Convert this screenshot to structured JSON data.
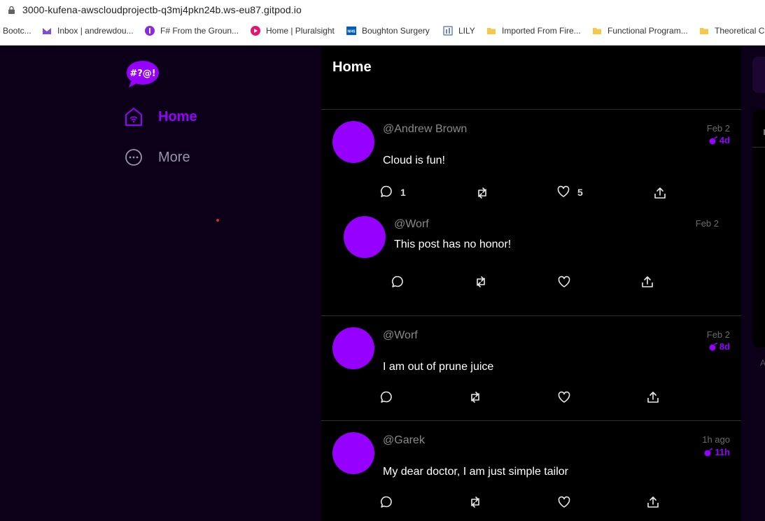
{
  "browser": {
    "url": "3000-kufena-awscloudprojectb-q3mj4pkn24b.ws-eu87.gitpod.io",
    "bookmarks": [
      {
        "label": "Bootc...",
        "color": "#ffffff"
      },
      {
        "label": "Inbox | andrewdou...",
        "color": "#7b4fd6"
      },
      {
        "label": "F# From the Groun...",
        "color": "#8a2be2"
      },
      {
        "label": "Home | Pluralsight",
        "color": "#e5156d"
      },
      {
        "label": "Boughton Surgery",
        "color": "#005eb8"
      },
      {
        "label": "LILY",
        "color": "#6b7fd6"
      },
      {
        "label": "Imported From Fire...",
        "color": "#f5c84a"
      },
      {
        "label": "Functional Program...",
        "color": "#f5c84a"
      },
      {
        "label": "Theoretical Co",
        "color": "#f5c84a"
      }
    ]
  },
  "app": {
    "logo_text": "#?@!",
    "accent": "#9500ff"
  },
  "nav": {
    "home": "Home",
    "more": "More"
  },
  "feed": {
    "title": "Home",
    "activities": [
      {
        "handle": "@Andrew Brown",
        "message": "Cloud is fun!",
        "date": "Feb 2",
        "expires": "4d",
        "replies": "1",
        "likes": "5"
      },
      {
        "handle": "@Worf",
        "message": "This post has no honor!",
        "date": "Feb 2"
      },
      {
        "handle": "@Worf",
        "message": "I am out of prune juice",
        "date": "Feb 2",
        "expires": "8d"
      },
      {
        "handle": "@Garek",
        "message": "My dear doctor, I am just simple tailor",
        "date": "1h ago",
        "expires": "11h"
      }
    ]
  },
  "right": {
    "fragment": "A"
  }
}
